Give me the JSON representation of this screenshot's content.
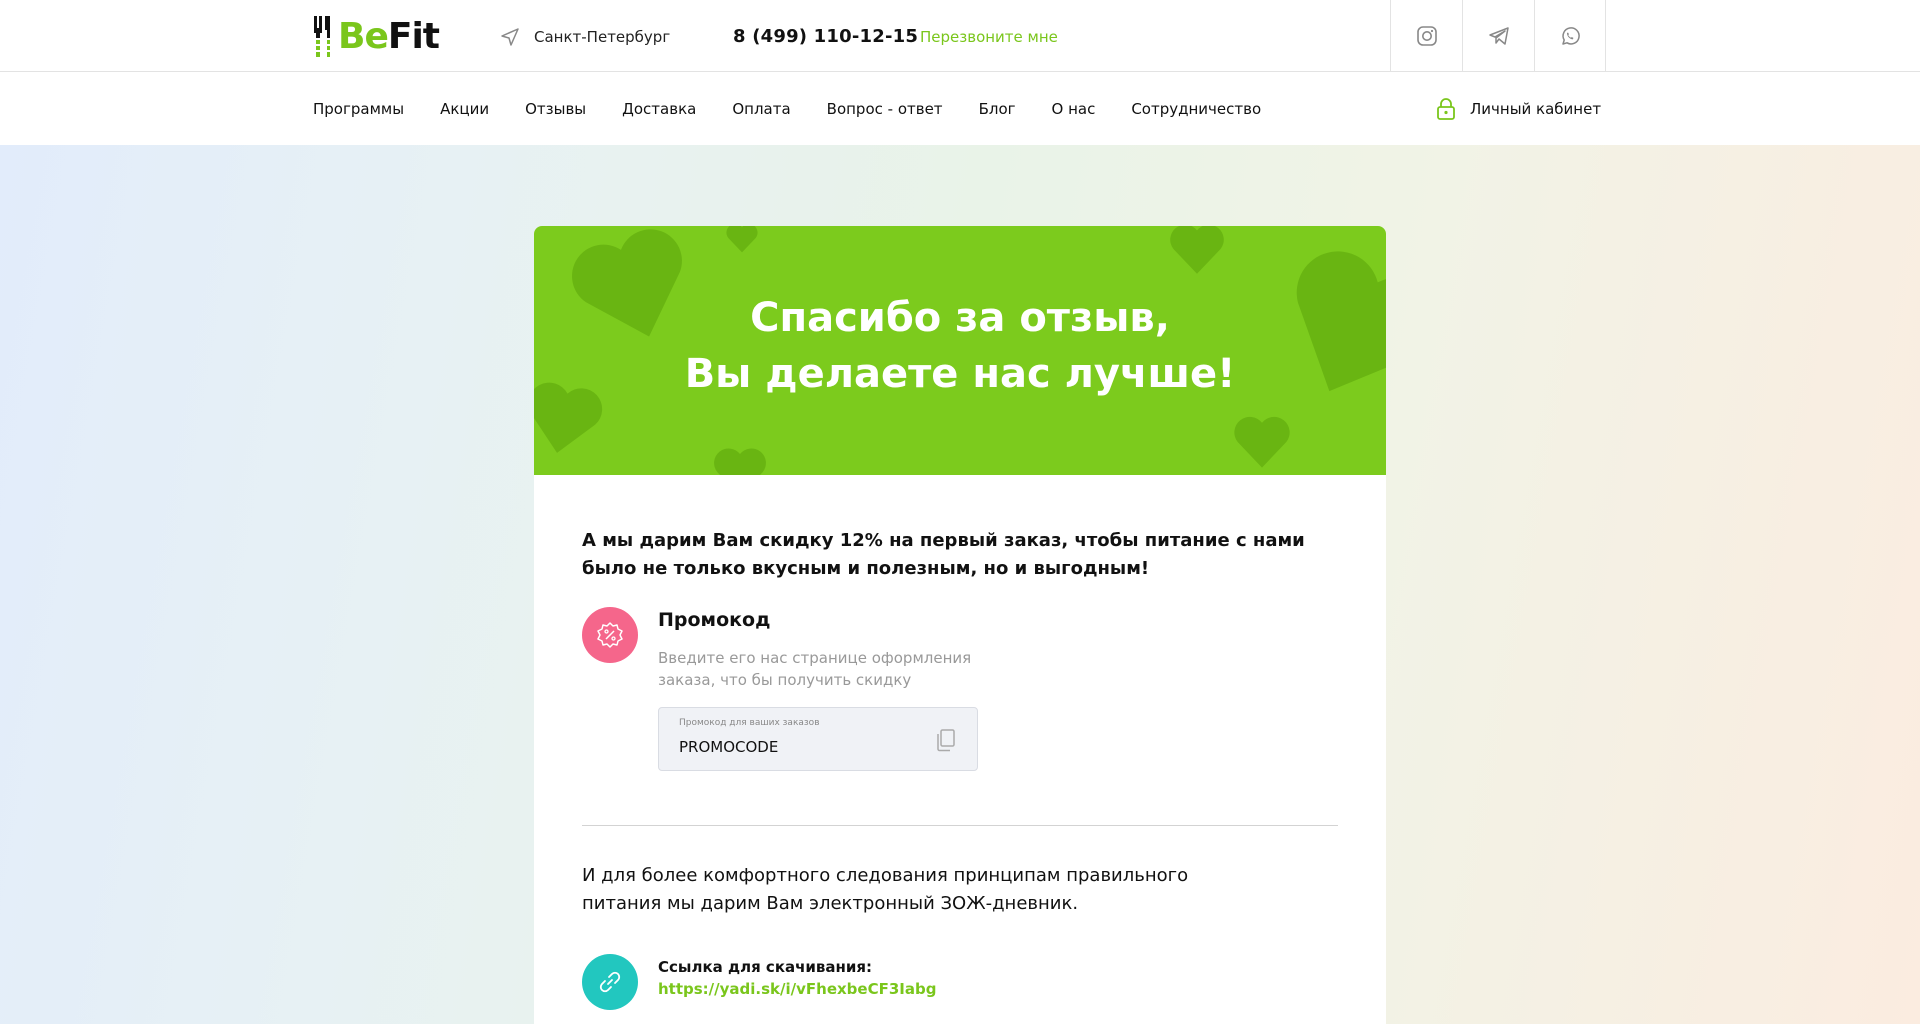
{
  "header": {
    "logo": {
      "part1": "Be",
      "part2": "Fit"
    },
    "city": "Санкт-Петербург",
    "phone": "8 (499) 110-12-15",
    "callback": "Перезвоните мне",
    "socials": [
      "instagram-icon",
      "telegram-icon",
      "whatsapp-icon"
    ]
  },
  "nav": {
    "items": [
      "Программы",
      "Акции",
      "Отзывы",
      "Доставка",
      "Оплата",
      "Вопрос - ответ",
      "Блог",
      "О нас",
      "Сотрудничество"
    ],
    "cabinet": "Личный кабинет"
  },
  "banner": {
    "line1": "Спасибо за отзыв,",
    "line2": "Вы делаете нас лучше!"
  },
  "content": {
    "lead": "А мы дарим Вам скидку 12% на первый заказ, чтобы питание с нами было не только вкусным и полезным, но и выгодным!",
    "promo_title": "Промокод",
    "promo_desc": "Введите его нас странице оформления заказа, что бы получить скидку",
    "promo_field_label": "Промокод для ваших заказов",
    "promo_code": "PROMOCODE",
    "diary": "И для более комфортного следования принципам правильного питания мы дарим Вам электронный ЗОЖ-дневник.",
    "download_label": "Ссылка для скачивания:",
    "download_link": "https://yadi.sk/i/vFhexbeCF3Iabg"
  },
  "colors": {
    "brand_green": "#7ac61c",
    "banner_green": "#7ccb1d",
    "promo_pink": "#f5668b",
    "link_teal": "#22c7bf"
  }
}
